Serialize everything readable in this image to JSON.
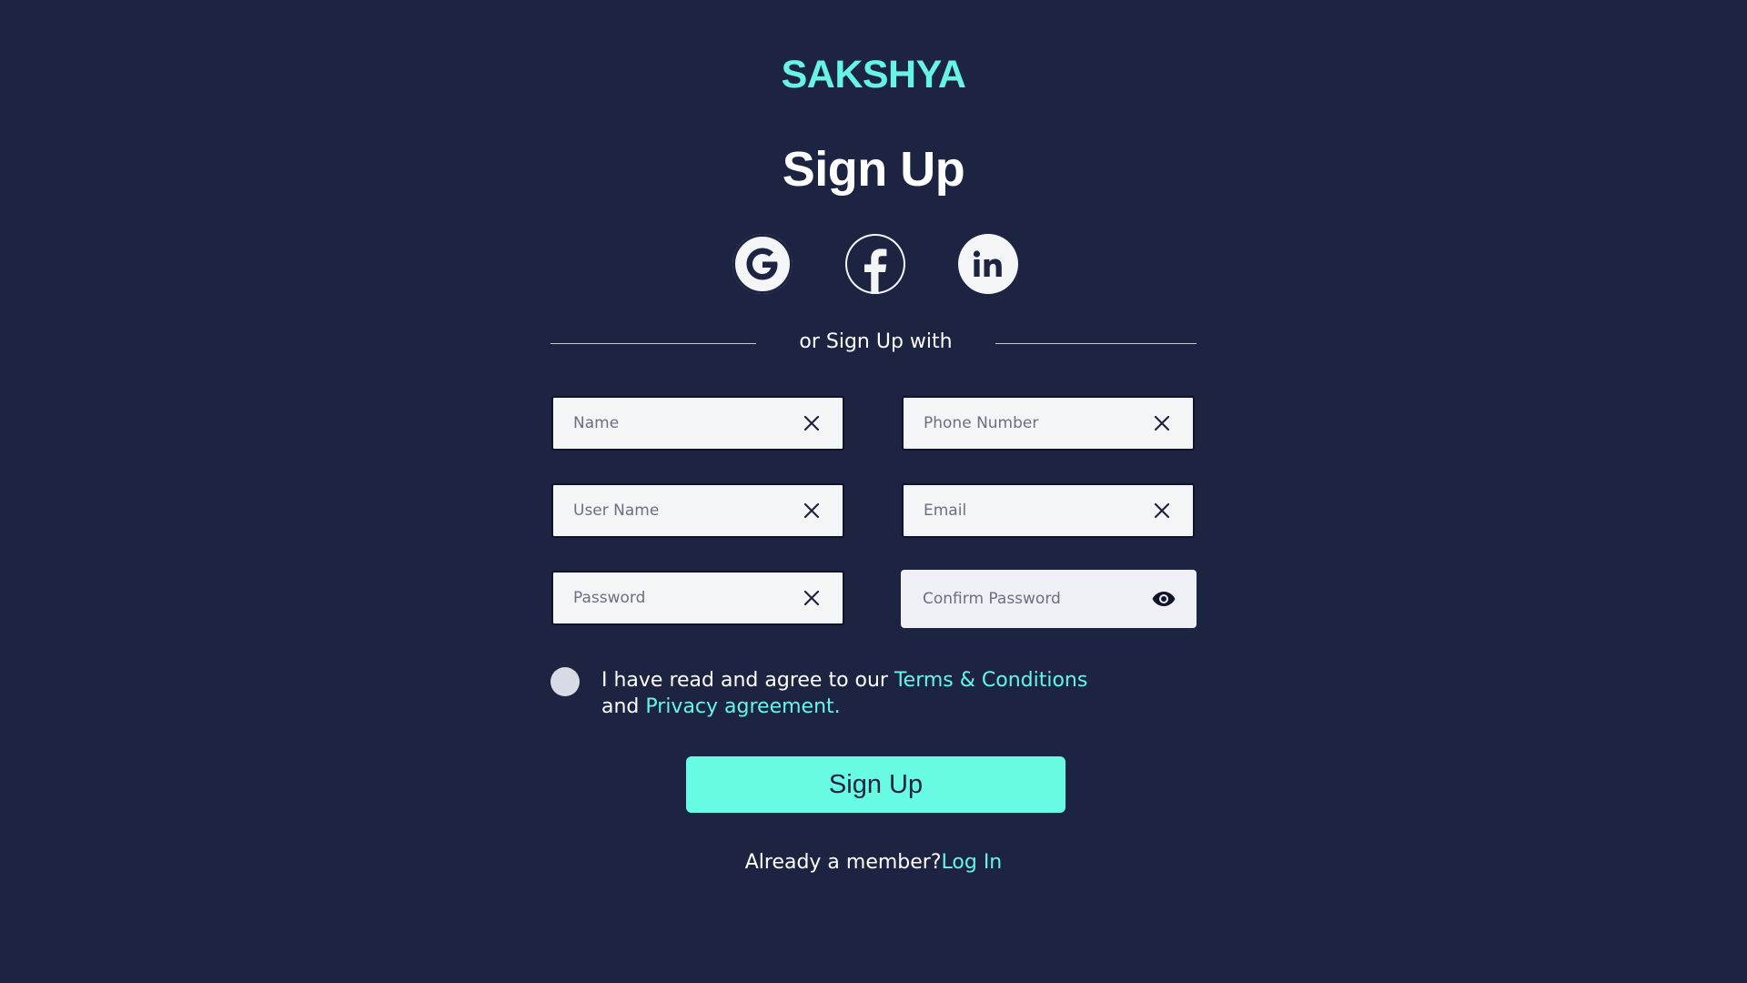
{
  "brand": "SAKSHYA",
  "title": "Sign Up",
  "social": [
    {
      "name": "google",
      "icon": "google-icon"
    },
    {
      "name": "facebook",
      "icon": "facebook-icon"
    },
    {
      "name": "linkedin",
      "icon": "linkedin-icon"
    }
  ],
  "divider_text": "or Sign Up with",
  "fields": {
    "name": {
      "placeholder": "Name",
      "value": "",
      "icon": "close-icon"
    },
    "phone": {
      "placeholder": "Phone Number",
      "value": "",
      "icon": "close-icon"
    },
    "username": {
      "placeholder": "User Name",
      "value": "",
      "icon": "close-icon"
    },
    "email": {
      "placeholder": "Email",
      "value": "",
      "icon": "close-icon"
    },
    "password": {
      "placeholder": "Password",
      "value": "",
      "icon": "close-icon"
    },
    "confirm_password": {
      "placeholder": "Confirm Password",
      "value": "",
      "icon": "eye-icon"
    }
  },
  "agreement": {
    "prefix": "I have read and agree to our ",
    "terms_link": "Terms & Conditions",
    "middle": "and ",
    "privacy_link": "Privacy agreement.",
    "checked": false
  },
  "submit_label": "Sign Up",
  "member": {
    "prompt": "Already a member?",
    "login_link": "Log In"
  },
  "colors": {
    "background": "#1c2442",
    "accent": "#67f5e3",
    "button": "#67fbe4",
    "field_bg": "#f4f5f7"
  }
}
